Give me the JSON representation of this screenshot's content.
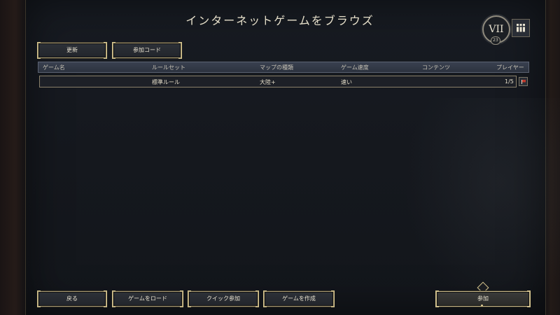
{
  "header": {
    "title": "インターネットゲームをブラウズ",
    "era_badge": "VII",
    "era_number": "23"
  },
  "toolbar": {
    "refresh_label": "更新",
    "join_code_label": "参加コード"
  },
  "table": {
    "columns": [
      "ゲーム名",
      "ルールセット",
      "マップの種類",
      "ゲーム速度",
      "コンテンツ",
      "プレイヤー"
    ],
    "rows": [
      {
        "game_name": "",
        "ruleset": "標準ルール",
        "map_type": "大陸+",
        "game_speed": "速い",
        "content": "",
        "players": "1/5"
      }
    ]
  },
  "footer": {
    "back_label": "戻る",
    "load_game_label": "ゲームをロード",
    "quick_join_label": "クイック参加",
    "create_game_label": "ゲームを作成",
    "join_label": "参加"
  },
  "colors": {
    "accent_gold": "#d8c78f",
    "panel_bg": "#15181e",
    "header_bg": "#2c323e",
    "flag_red": "#c0392b"
  },
  "icons": {
    "menu": "grid-menu-icon",
    "flag": "report-flag-icon"
  }
}
